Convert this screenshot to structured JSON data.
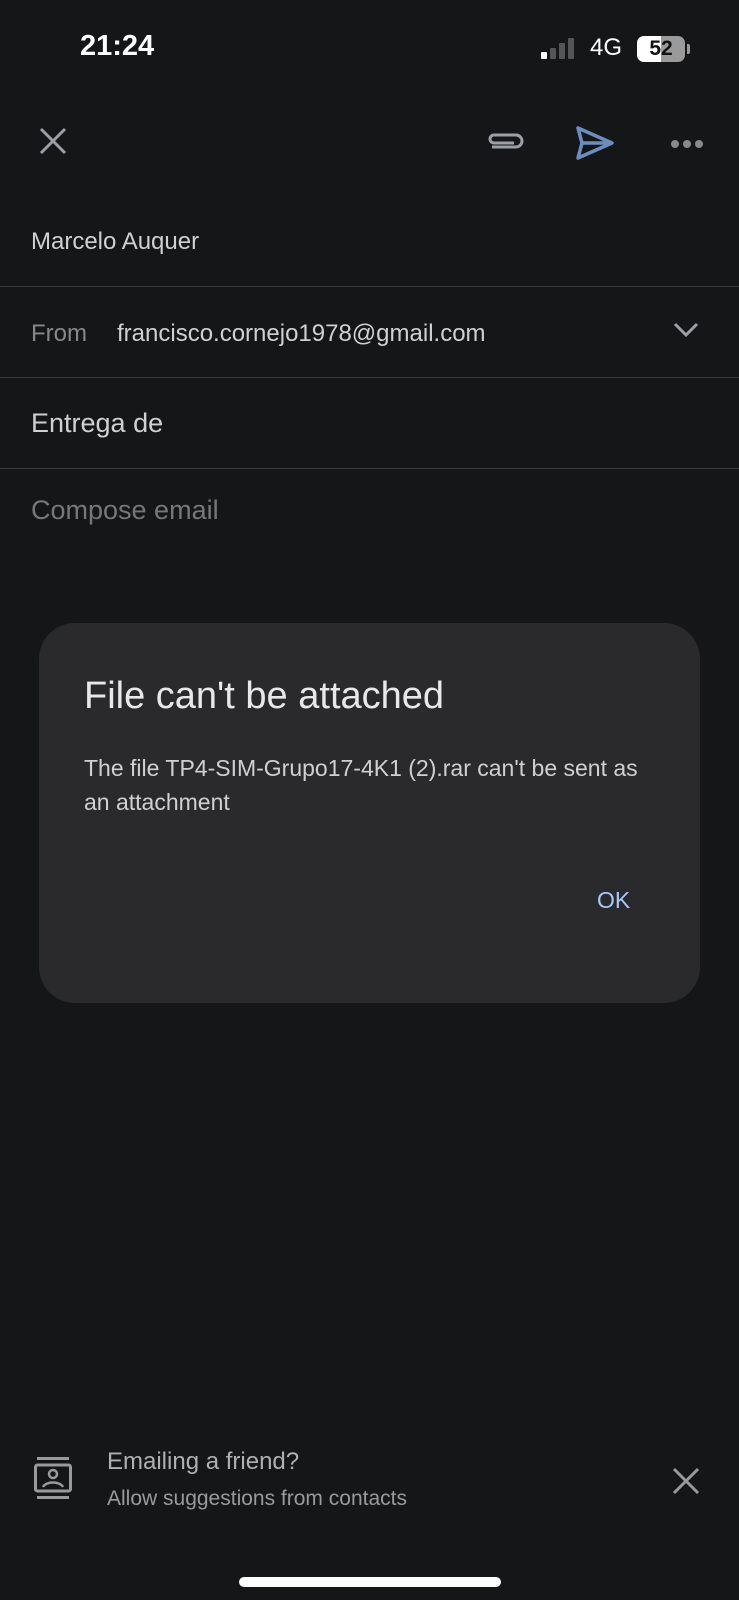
{
  "status_bar": {
    "time": "21:24",
    "network": "4G",
    "battery": "52",
    "battery_level_percent": 52,
    "signal_bars": 1
  },
  "toolbar": {
    "close_icon": "close-icon",
    "attach_icon": "paperclip-icon",
    "send_icon": "send-icon",
    "more_icon": "more-horizontal-icon",
    "send_color": "#6c8ebf"
  },
  "compose": {
    "to": "Marcelo Auquer",
    "from_label": "From",
    "from_value": "francisco.cornejo1978@gmail.com",
    "subject": "Entrega de",
    "body_placeholder": "Compose email"
  },
  "dialog": {
    "title": "File can't be attached",
    "message": "The file TP4-SIM-Grupo17-4K1 (2).rar can't be sent as an attachment",
    "ok_label": "OK"
  },
  "suggestion": {
    "title": "Emailing a friend?",
    "subtitle": "Allow suggestions from contacts"
  }
}
